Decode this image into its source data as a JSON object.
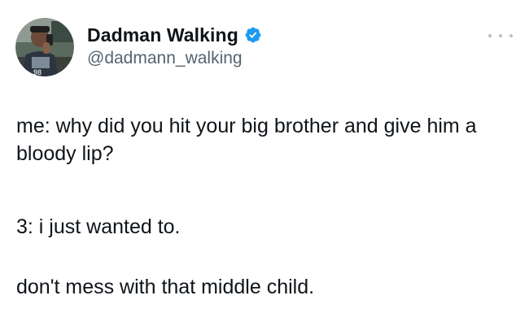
{
  "author": {
    "display_name": "Dadman Walking",
    "handle": "@dadmann_walking",
    "verified": true,
    "avatar_icon": "user-avatar"
  },
  "more_icon": "ellipsis-icon",
  "tweet": {
    "paragraph_1": "me: why did you hit your big brother and give him a bloody lip?",
    "paragraph_2": "3: i just wanted to.",
    "paragraph_3": "don't mess with that middle child."
  },
  "colors": {
    "text_primary": "#0f1419",
    "text_secondary": "#536471",
    "verified_badge": "#1d9bf0",
    "background": "#ffffff"
  }
}
